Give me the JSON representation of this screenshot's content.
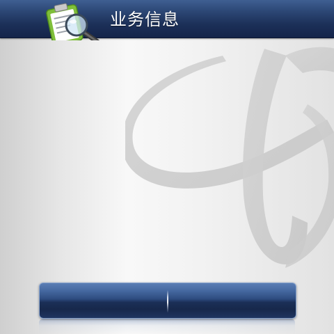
{
  "header": {
    "title": "业务信息",
    "icon": "clipboard-magnifier-icon"
  },
  "watermark": {
    "icon": "china-telecom-logo"
  },
  "bottom_bar": {
    "left_button_label": "",
    "right_button_label": ""
  },
  "colors": {
    "header_dark": "#14244a",
    "header_light": "#3f5f92",
    "bar_blue": "#2e4c80",
    "background_light": "#f4f4f4",
    "clipboard_green": "#8cc63f"
  }
}
